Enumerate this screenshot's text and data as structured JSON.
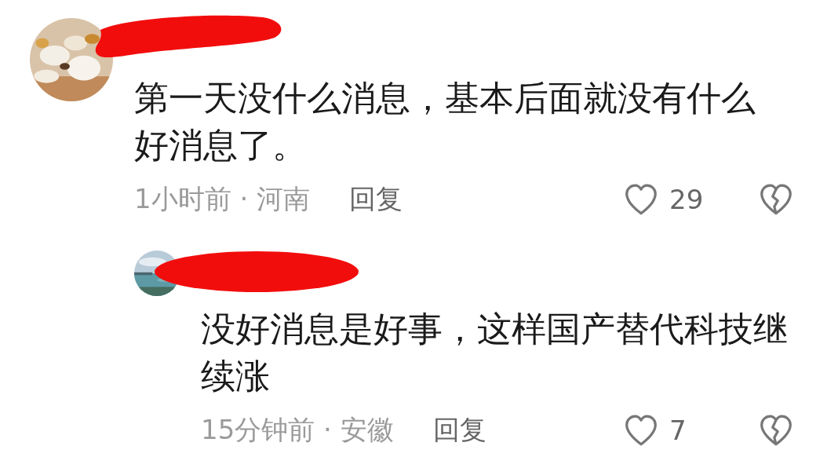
{
  "comments": [
    {
      "avatar": {
        "kind": "food"
      },
      "name_redacted": true,
      "text": "第一天没什么消息，基本后面就没有什么好消息了。",
      "time": "1小时前",
      "separator": "·",
      "location": "河南",
      "reply_label": "回复",
      "likes": "29",
      "children": [
        {
          "avatar": {
            "kind": "sea"
          },
          "name_redacted": true,
          "text": "没好消息是好事，这样国产替代科技继续涨",
          "time": "15分钟前",
          "separator": "·",
          "location": "安徽",
          "reply_label": "回复",
          "likes": "7"
        }
      ]
    }
  ]
}
